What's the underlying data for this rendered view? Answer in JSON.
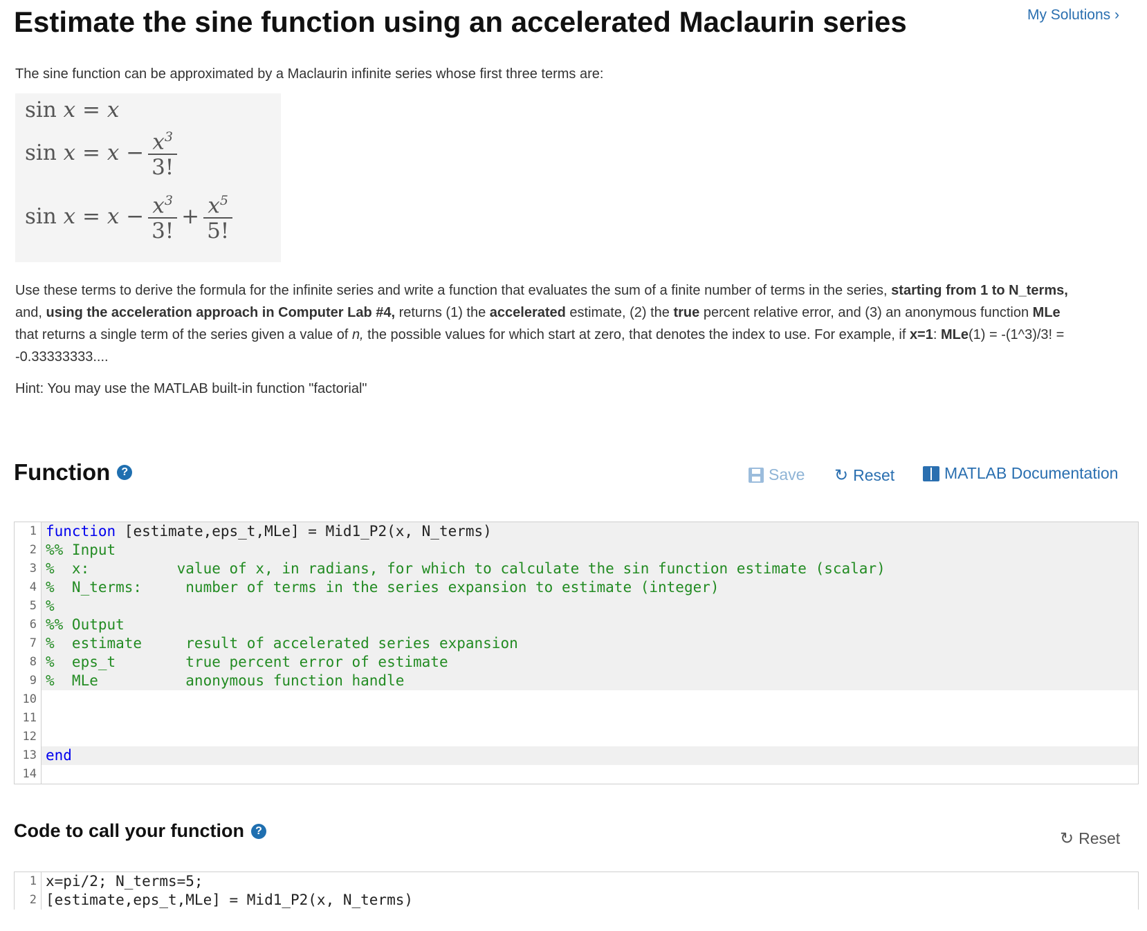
{
  "header": {
    "title": "Estimate the sine function using an accelerated Maclaurin series",
    "my_solutions": "My Solutions ›"
  },
  "intro": "The sine function can be approximated by a Maclaurin infinite series whose first three terms are:",
  "formula": {
    "sin": "sin",
    "x": "x",
    "eq": "=",
    "minus": "−",
    "plus": "+",
    "exp3": "3",
    "exp5": "5",
    "fact3": "3!",
    "fact5": "5!"
  },
  "description": {
    "p1": "Use these terms to derive the formula for the infinite series and write a function that evaluates the sum of a finite number of terms in the series, ",
    "b1": "starting from 1 to N_terms,",
    "p2": " and, ",
    "b2": "using the acceleration approach in Computer Lab #4,",
    "p3": " returns (1) the ",
    "b3": "accelerated",
    "p4": " estimate, (2) the ",
    "b4": "true",
    "p5": " percent relative error, and (3) an anonymous function ",
    "b5": "MLe",
    "p6": " that returns a single term of the series given a value of ",
    "i1": "n,",
    "p7": " the possible values for which start at zero, that denotes the index to use. For example, if ",
    "b6": "x=1",
    "p8": ":  ",
    "b7": "MLe",
    "p9": "(1) = -(1^3)/3! = -0.33333333...."
  },
  "hint": "Hint: You may use the MATLAB built-in function \"factorial\"",
  "function_section": {
    "title": "Function",
    "help": "?",
    "save": "Save",
    "reset": "Reset",
    "docs": "MATLAB Documentation",
    "lines": [
      {
        "n": "1",
        "kw": "function",
        "rest": " [estimate,eps_t,MLe] = Mid1_P2(x, N_terms)",
        "comment": ""
      },
      {
        "n": "2",
        "kw": "",
        "rest": "",
        "comment": "%% Input"
      },
      {
        "n": "3",
        "kw": "",
        "rest": "",
        "comment": "%  x:          value of x, in radians, for which to calculate the sin function estimate (scalar)"
      },
      {
        "n": "4",
        "kw": "",
        "rest": "",
        "comment": "%  N_terms:     number of terms in the series expansion to estimate (integer)"
      },
      {
        "n": "5",
        "kw": "",
        "rest": "",
        "comment": "%"
      },
      {
        "n": "6",
        "kw": "",
        "rest": "",
        "comment": "%% Output"
      },
      {
        "n": "7",
        "kw": "",
        "rest": "",
        "comment": "%  estimate     result of accelerated series expansion"
      },
      {
        "n": "8",
        "kw": "",
        "rest": "",
        "comment": "%  eps_t        true percent error of estimate"
      },
      {
        "n": "9",
        "kw": "",
        "rest": "",
        "comment": "%  MLe          anonymous function handle"
      },
      {
        "n": "10",
        "kw": "",
        "rest": "",
        "comment": ""
      },
      {
        "n": "11",
        "kw": "",
        "rest": "",
        "comment": ""
      },
      {
        "n": "12",
        "kw": "",
        "rest": "",
        "comment": ""
      },
      {
        "n": "13",
        "kw": "end",
        "rest": "",
        "comment": ""
      },
      {
        "n": "14",
        "kw": "",
        "rest": "",
        "comment": ""
      }
    ]
  },
  "call_section": {
    "title": "Code to call your function",
    "help": "?",
    "reset": "Reset",
    "lines": [
      {
        "n": "1",
        "code": "x=pi/2; N_terms=5;"
      },
      {
        "n": "2",
        "code": "[estimate,eps_t,MLe] = Mid1_P2(x, N_terms)"
      }
    ]
  }
}
